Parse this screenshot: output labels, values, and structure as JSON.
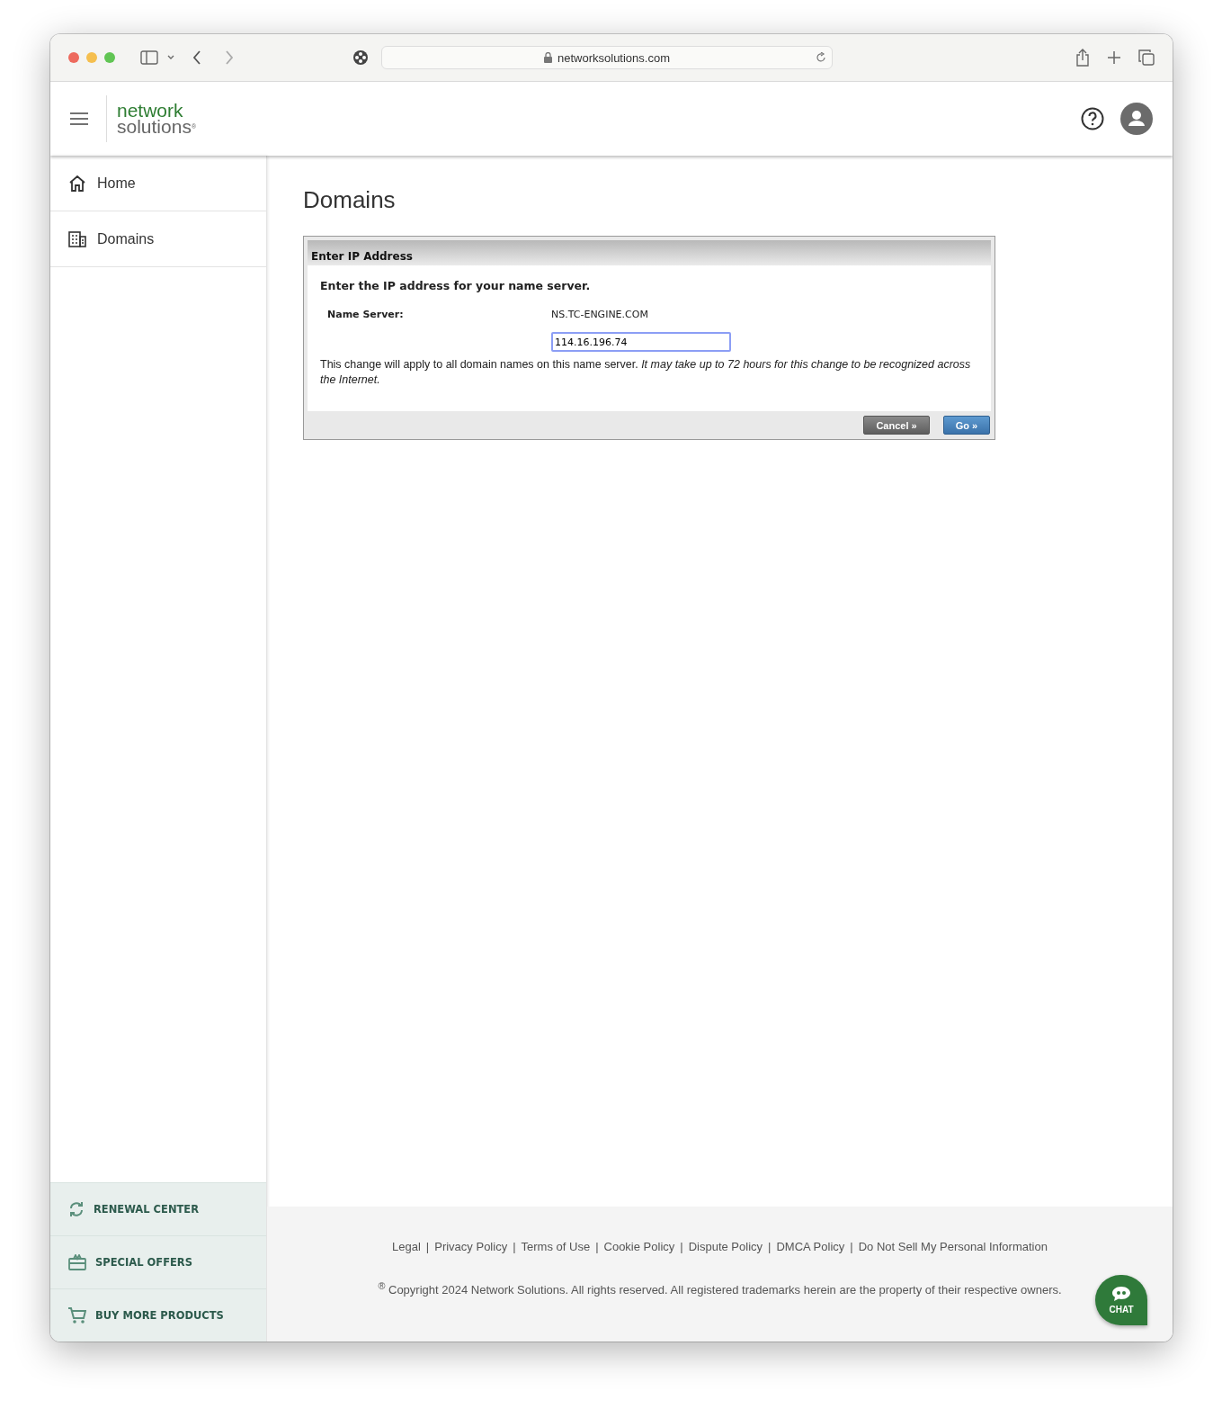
{
  "browser": {
    "url": "networksolutions.com"
  },
  "header": {
    "logo_top": "network",
    "logo_bottom": "solutions",
    "logo_mark": "®"
  },
  "sidebar": {
    "items": [
      {
        "label": "Home",
        "kind": "home",
        "selected": false
      },
      {
        "label": "Domains",
        "kind": "building",
        "selected": false
      }
    ],
    "bottom_items": [
      {
        "label": "RENEWAL CENTER",
        "kind": "renew"
      },
      {
        "label": "SPECIAL OFFERS",
        "kind": "gift"
      },
      {
        "label": "BUY MORE PRODUCTS",
        "kind": "cart"
      }
    ]
  },
  "page_title": "Domains",
  "dialog": {
    "title": "Enter IP Address",
    "instruction": "Enter the IP address for your name server.",
    "name_server_label": "Name Server:",
    "name_server_value": "NS.TC-ENGINE.COM",
    "ip_value": "114.16.196.74",
    "note": "This change will apply to all domain names on this name server. *It may take up to 72 hours for this change to be recognized across the Internet.*",
    "buttons": [
      {
        "label": "Cancel »",
        "kind": "secondary"
      },
      {
        "label": "Go »",
        "kind": "primary"
      }
    ]
  },
  "footer": {
    "separator": "|",
    "links": [
      "Legal",
      "Privacy Policy",
      "Terms of Use",
      "Cookie Policy",
      "Dispute Policy",
      "DMCA Policy",
      "Do Not Sell My Personal Information"
    ],
    "copyright": "$^{®}$ Copyright 2024 Network Solutions. All rights reserved. All registered trademarks herein are the property of their respective owners."
  },
  "chat": {
    "label": "CHAT"
  }
}
